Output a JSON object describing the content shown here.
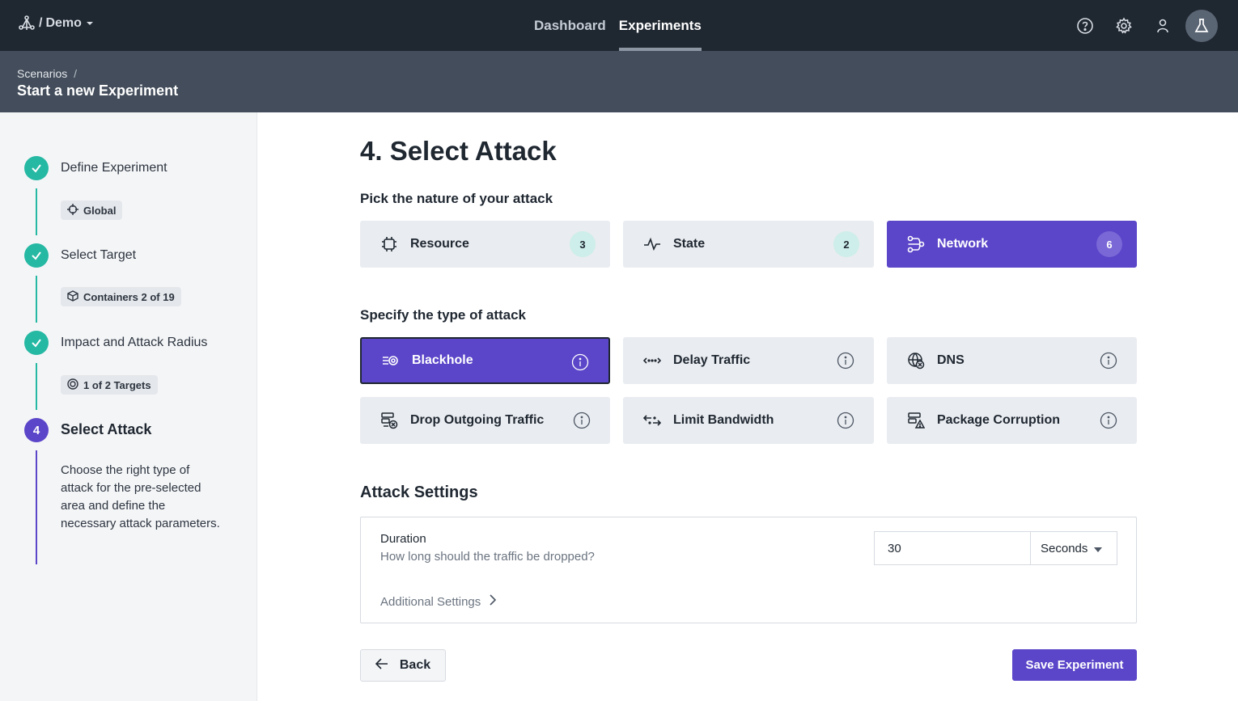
{
  "topbar": {
    "workspace": "Demo",
    "brand_separator": "/",
    "nav": [
      {
        "label": "Dashboard",
        "active": false
      },
      {
        "label": "Experiments",
        "active": true
      }
    ],
    "icons": [
      "help-icon",
      "gear-icon",
      "user-icon",
      "flask-icon"
    ]
  },
  "header": {
    "breadcrumb": "Scenarios",
    "breadcrumb_sep": "/",
    "title": "Start a new Experiment"
  },
  "wizard": {
    "steps": [
      {
        "label": "Define Experiment",
        "status": "done",
        "chip": "Global",
        "chip_icon": "crosshair-icon"
      },
      {
        "label": "Select Target",
        "status": "done",
        "chip": "Containers 2 of 19",
        "chip_icon": "container-icon"
      },
      {
        "label": "Impact and Attack Radius",
        "status": "done",
        "chip": "1 of 2 Targets",
        "chip_icon": "target-icon"
      },
      {
        "label": "Select Attack",
        "status": "current",
        "number": "4",
        "description": "Choose the right type of attack for the pre-selected area and define the necessary attack parameters."
      }
    ]
  },
  "main": {
    "title": "4. Select Attack",
    "nature_title": "Pick the nature of your attack",
    "natures": [
      {
        "label": "Resource",
        "count": "3",
        "icon": "chip-icon",
        "selected": false
      },
      {
        "label": "State",
        "count": "2",
        "icon": "pulse-icon",
        "selected": false
      },
      {
        "label": "Network",
        "count": "6",
        "icon": "network-icon",
        "selected": true
      }
    ],
    "type_title": "Specify the type of attack",
    "types": [
      {
        "label": "Blackhole",
        "icon": "blackhole-icon",
        "selected": true
      },
      {
        "label": "Delay Traffic",
        "icon": "delay-icon",
        "selected": false
      },
      {
        "label": "DNS",
        "icon": "globe-icon",
        "selected": false
      },
      {
        "label": "Drop Outgoing Traffic",
        "icon": "drop-traffic-icon",
        "selected": false
      },
      {
        "label": "Limit Bandwidth",
        "icon": "bandwidth-icon",
        "selected": false
      },
      {
        "label": "Package Corruption",
        "icon": "corruption-icon",
        "selected": false
      }
    ],
    "settings_title": "Attack Settings",
    "settings": {
      "duration_label": "Duration",
      "duration_help": "How long should the traffic be dropped?",
      "duration_value": "30",
      "duration_unit": "Seconds",
      "additional": "Additional Settings"
    },
    "back_label": "Back",
    "save_label": "Save Experiment"
  },
  "colors": {
    "accent": "#5b45c9",
    "done": "#25b8a3",
    "topbar": "#1f2731",
    "subheader": "#434d5b"
  }
}
